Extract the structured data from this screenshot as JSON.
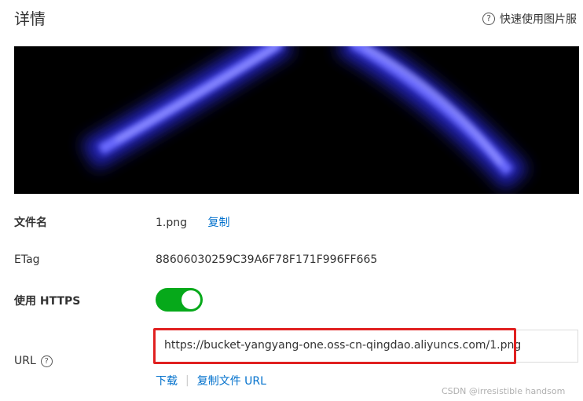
{
  "header": {
    "title": "详情",
    "help_text": "快速使用图片服"
  },
  "fields": {
    "filename": {
      "label": "文件名",
      "value": "1.png",
      "copy_label": "复制"
    },
    "etag": {
      "label": "ETag",
      "value": "88606030259C39A6F78F171F996FF665"
    },
    "https": {
      "label": "使用 HTTPS",
      "enabled": true
    },
    "url": {
      "label": "URL",
      "value": "https://bucket-yangyang-one.oss-cn-qingdao.aliyuncs.com/1.png",
      "download_label": "下载",
      "separator": "|",
      "copy_url_label": "复制文件 URL"
    }
  },
  "icons": {
    "help": "question-circle-icon"
  },
  "colors": {
    "toggle_on": "#06a91a",
    "link": "#0070cc",
    "highlight": "#e02020"
  },
  "watermark": "CSDN @irresistible handsom"
}
